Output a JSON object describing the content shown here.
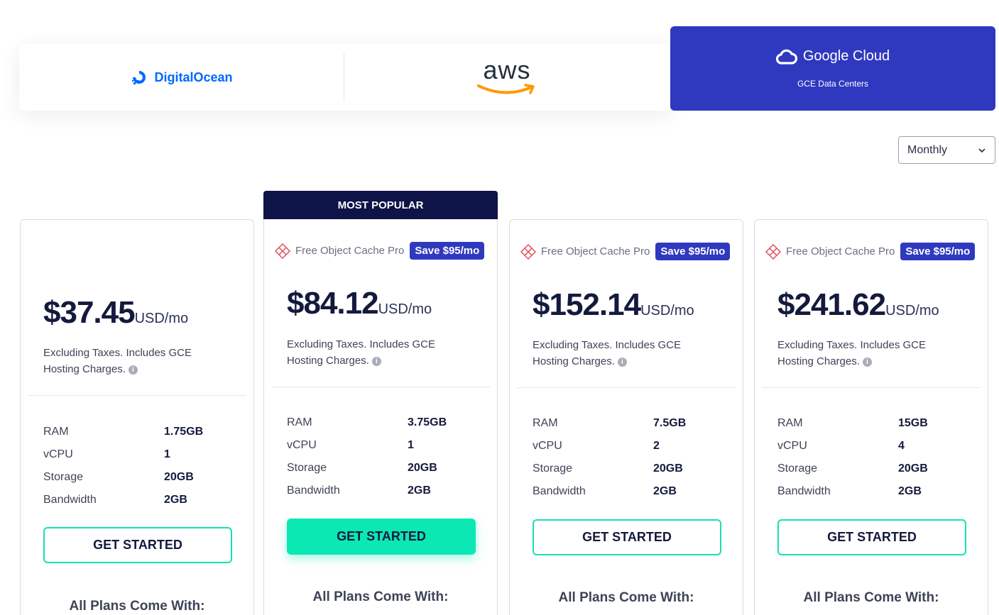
{
  "providers": {
    "digitalocean": {
      "label": "DigitalOcean"
    },
    "aws": {
      "label": "aws"
    },
    "gcp": {
      "label": "Google Cloud",
      "sub": "GCE Data Centers"
    }
  },
  "billing": {
    "selected": "Monthly"
  },
  "popular_label": "MOST POPULAR",
  "promo": {
    "text": "Free Object Cache Pro",
    "badge": "Save $95/mo"
  },
  "plans": [
    {
      "price": "$37.45",
      "unit": "USD/mo",
      "note": "Excluding Taxes. Includes GCE Hosting Charges.",
      "specs": [
        {
          "k": "RAM",
          "v": "1.75GB"
        },
        {
          "k": "vCPU",
          "v": "1"
        },
        {
          "k": "Storage",
          "v": "20GB"
        },
        {
          "k": "Bandwidth",
          "v": "2GB"
        }
      ],
      "cta": "GET STARTED",
      "footer": "All Plans Come With:"
    },
    {
      "price": "$84.12",
      "unit": "USD/mo",
      "note": "Excluding Taxes. Includes GCE Hosting Charges.",
      "specs": [
        {
          "k": "RAM",
          "v": "3.75GB"
        },
        {
          "k": "vCPU",
          "v": "1"
        },
        {
          "k": "Storage",
          "v": "20GB"
        },
        {
          "k": "Bandwidth",
          "v": "2GB"
        }
      ],
      "cta": "GET STARTED",
      "footer": "All Plans Come With:"
    },
    {
      "price": "$152.14",
      "unit": "USD/mo",
      "note": "Excluding Taxes. Includes GCE Hosting Charges.",
      "specs": [
        {
          "k": "RAM",
          "v": "7.5GB"
        },
        {
          "k": "vCPU",
          "v": "2"
        },
        {
          "k": "Storage",
          "v": "20GB"
        },
        {
          "k": "Bandwidth",
          "v": "2GB"
        }
      ],
      "cta": "GET STARTED",
      "footer": "All Plans Come With:"
    },
    {
      "price": "$241.62",
      "unit": "USD/mo",
      "note": "Excluding Taxes. Includes GCE Hosting Charges.",
      "specs": [
        {
          "k": "RAM",
          "v": "15GB"
        },
        {
          "k": "vCPU",
          "v": "4"
        },
        {
          "k": "Storage",
          "v": "20GB"
        },
        {
          "k": "Bandwidth",
          "v": "2GB"
        }
      ],
      "cta": "GET STARTED",
      "footer": "All Plans Come With:"
    }
  ]
}
